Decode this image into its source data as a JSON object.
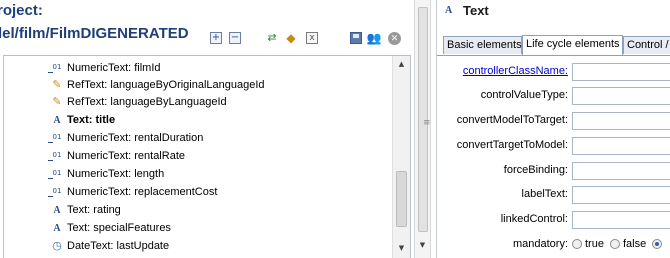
{
  "left_pane": {
    "header_label": "roject:",
    "path": "lel/film/FilmDIGENERATED",
    "toolbar": {
      "expand_icon": "+",
      "collapse_icon": "−",
      "link_icon": "⇄",
      "sort_icon": "◆",
      "close_icon": "x",
      "people_icon": "👥",
      "stop_icon": "✕"
    },
    "tree_items": [
      {
        "label": "NumericText: filmId",
        "icon": "numeric-icon",
        "selected": false
      },
      {
        "label": "RefText: languageByOriginalLanguageId",
        "icon": "ref-icon",
        "selected": false
      },
      {
        "label": "RefText: languageByLanguageId",
        "icon": "ref-icon",
        "selected": false
      },
      {
        "label": "Text: title",
        "icon": "text-icon",
        "selected": true
      },
      {
        "label": "NumericText: rentalDuration",
        "icon": "numeric-icon",
        "selected": false
      },
      {
        "label": "NumericText: rentalRate",
        "icon": "numeric-icon",
        "selected": false
      },
      {
        "label": "NumericText: length",
        "icon": "numeric-icon",
        "selected": false
      },
      {
        "label": "NumericText: replacementCost",
        "icon": "numeric-icon",
        "selected": false
      },
      {
        "label": "Text: rating",
        "icon": "text-icon",
        "selected": false
      },
      {
        "label": "Text: specialFeatures",
        "icon": "text-icon",
        "selected": false
      },
      {
        "label": "DateText: lastUpdate",
        "icon": "date-icon",
        "selected": false
      }
    ],
    "sash_handle": "≡"
  },
  "right_pane": {
    "title": "Text",
    "title_icon": "A",
    "tabs": [
      {
        "label": "Basic elements"
      },
      {
        "label": "Life cycle elements"
      },
      {
        "label": "Control / D"
      }
    ],
    "properties": [
      {
        "label": "controllerClassName:",
        "link": true
      },
      {
        "label": "controlValueType:",
        "link": false
      },
      {
        "label": "convertModelToTarget:",
        "link": false
      },
      {
        "label": "convertTargetToModel:",
        "link": false
      },
      {
        "label": "forceBinding:",
        "link": false
      },
      {
        "label": "labelText:",
        "link": false
      },
      {
        "label": "linkedControl:",
        "link": false
      }
    ],
    "mandatory": {
      "label": "mandatory:",
      "options": [
        "true",
        "false"
      ],
      "selected": "none",
      "trailing_radio_selected": true
    }
  },
  "colors": {
    "header_blue": "#1f3f7a",
    "link_blue": "#0000cc",
    "tab_border": "#8fa0bb"
  }
}
